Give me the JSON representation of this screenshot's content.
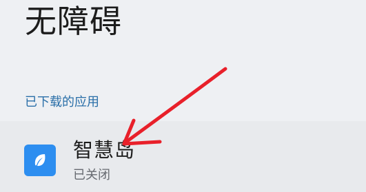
{
  "page": {
    "title": "无障碍"
  },
  "section": {
    "header": "已下载的应用"
  },
  "apps": [
    {
      "name": "智慧岛",
      "status": "已关闭",
      "icon": "leaf-icon",
      "icon_color": "#2d8ef0"
    }
  ],
  "colors": {
    "background": "#eef0f3",
    "accent": "#2a6fa8",
    "annotation_arrow": "#e8202a"
  }
}
